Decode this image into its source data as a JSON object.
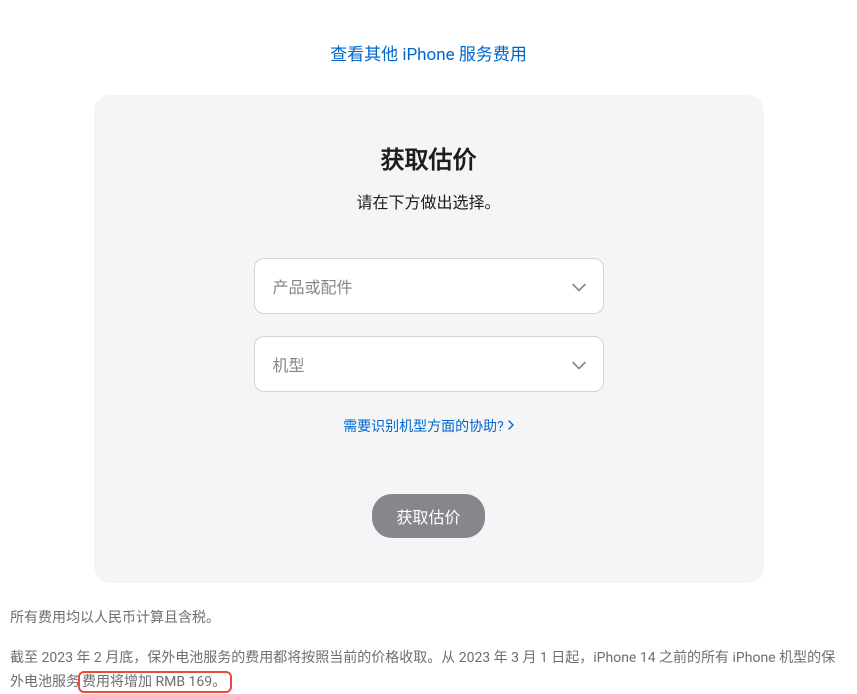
{
  "topLink": {
    "label": "查看其他 iPhone 服务费用"
  },
  "card": {
    "title": "获取估价",
    "subtitle": "请在下方做出选择。",
    "select1": {
      "placeholder": "产品或配件"
    },
    "select2": {
      "placeholder": "机型"
    },
    "helpLink": {
      "label": "需要识别机型方面的协助?"
    },
    "submit": {
      "label": "获取估价"
    }
  },
  "footer": {
    "line1": "所有费用均以人民币计算且含税。",
    "line2a": "截至 2023 年 2 月底，保外电池服务的费用都将按照当前的价格收取。从 2023 年 3 月 1 日起，iPhone 14 之前的所有 iPhone 机型的保外电池服务",
    "line2b": "费用将增加 RMB 169。"
  }
}
